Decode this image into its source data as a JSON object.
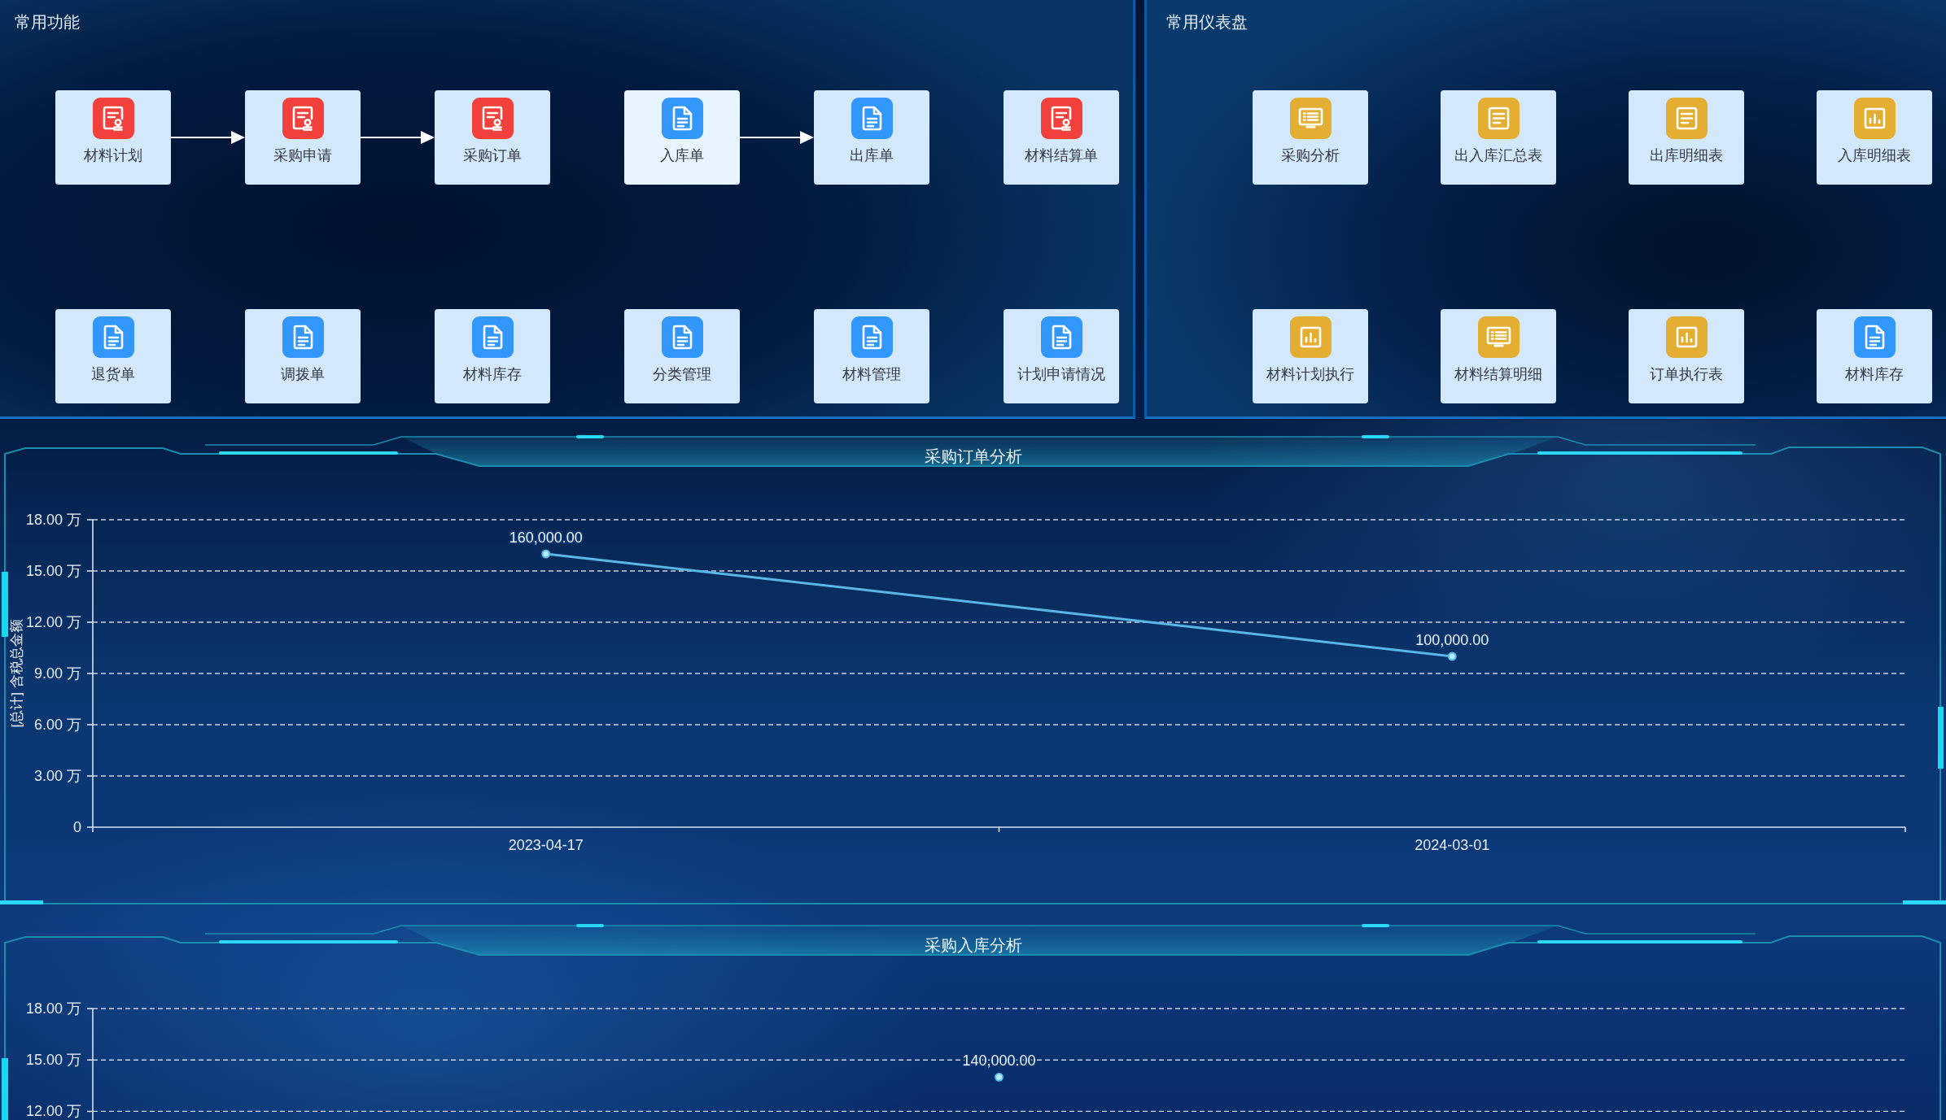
{
  "functions": {
    "title": "常用功能",
    "rows": [
      [
        {
          "label": "材料计划",
          "kind": "stamp",
          "color": "#f2403c",
          "highlighted": false,
          "arrow_to_next": true
        },
        {
          "label": "采购申请",
          "kind": "stamp",
          "color": "#f2403c",
          "highlighted": false,
          "arrow_to_next": true
        },
        {
          "label": "采购订单",
          "kind": "stamp",
          "color": "#f2403c",
          "highlighted": false,
          "arrow_to_next": false
        },
        {
          "label": "入库单",
          "kind": "doc",
          "color": "#3297fb",
          "highlighted": true,
          "arrow_to_next": true
        },
        {
          "label": "出库单",
          "kind": "doc",
          "color": "#3297fb",
          "highlighted": false,
          "arrow_to_next": false
        },
        {
          "label": "材料结算单",
          "kind": "stamp",
          "color": "#f2403c",
          "highlighted": false,
          "arrow_to_next": false
        }
      ],
      [
        {
          "label": "退货单",
          "kind": "doc",
          "color": "#3297fb",
          "highlighted": false,
          "arrow_to_next": false
        },
        {
          "label": "调拨单",
          "kind": "doc",
          "color": "#3297fb",
          "highlighted": false,
          "arrow_to_next": false
        },
        {
          "label": "材料库存",
          "kind": "doc",
          "color": "#3297fb",
          "highlighted": false,
          "arrow_to_next": false
        },
        {
          "label": "分类管理",
          "kind": "doc",
          "color": "#3297fb",
          "highlighted": false,
          "arrow_to_next": false
        },
        {
          "label": "材料管理",
          "kind": "doc",
          "color": "#3297fb",
          "highlighted": false,
          "arrow_to_next": false
        },
        {
          "label": "计划申请情况",
          "kind": "doc",
          "color": "#3297fb",
          "highlighted": false,
          "arrow_to_next": false
        }
      ]
    ]
  },
  "dashboards": {
    "title": "常用仪表盘",
    "rows": [
      [
        {
          "label": "采购分析",
          "kind": "screen",
          "color": "#e4ae32"
        },
        {
          "label": "出入库汇总表",
          "kind": "list",
          "color": "#e4ae32"
        },
        {
          "label": "出库明细表",
          "kind": "list",
          "color": "#e4ae32"
        },
        {
          "label": "入库明细表",
          "kind": "chart",
          "color": "#e4ae32"
        }
      ],
      [
        {
          "label": "材料计划执行",
          "kind": "chart",
          "color": "#e4ae32"
        },
        {
          "label": "材料结算明细",
          "kind": "screen",
          "color": "#e4ae32"
        },
        {
          "label": "订单执行表",
          "kind": "chart",
          "color": "#e4ae32"
        },
        {
          "label": "材料库存",
          "kind": "doc",
          "color": "#3297fb"
        }
      ]
    ]
  },
  "charts": [
    {
      "chart_data": {
        "type": "line",
        "title": "采购订单分析",
        "ylabel": "[总计] 含税总金额",
        "categories": [
          "2023-04-17",
          "2024-03-01"
        ],
        "series": [
          {
            "color": "#58b7e6",
            "marker": "circle",
            "values": [
              16,
              10
            ]
          }
        ],
        "ylim": [
          0,
          18
        ],
        "yticks": [
          0,
          {
            "value": 3,
            "label": "3.00 万"
          },
          {
            "value": 6,
            "label": "6.00 万"
          },
          {
            "value": 9,
            "label": "9.00 万"
          },
          {
            "value": 12,
            "label": "12.00 万"
          },
          {
            "value": 15,
            "label": "15.00 万"
          },
          {
            "value": 18,
            "label": "18.00 万"
          }
        ],
        "grid": true,
        "value_labels": [
          "160,000.00",
          "100,000.00"
        ]
      }
    },
    {
      "chart_data": {
        "type": "line",
        "title": "采购入库分析",
        "series": [
          {
            "color": "#58b7e6",
            "marker": "circle",
            "values": [
              14
            ]
          }
        ],
        "ylim": [
          11.5,
          18
        ],
        "yticks": [
          {
            "value": 12,
            "label": "12.00 万"
          },
          {
            "value": 15,
            "label": "15.00 万"
          },
          {
            "value": 18,
            "label": "18.00 万"
          }
        ],
        "grid": true,
        "value_labels": [
          "140,000.00"
        ]
      }
    }
  ]
}
